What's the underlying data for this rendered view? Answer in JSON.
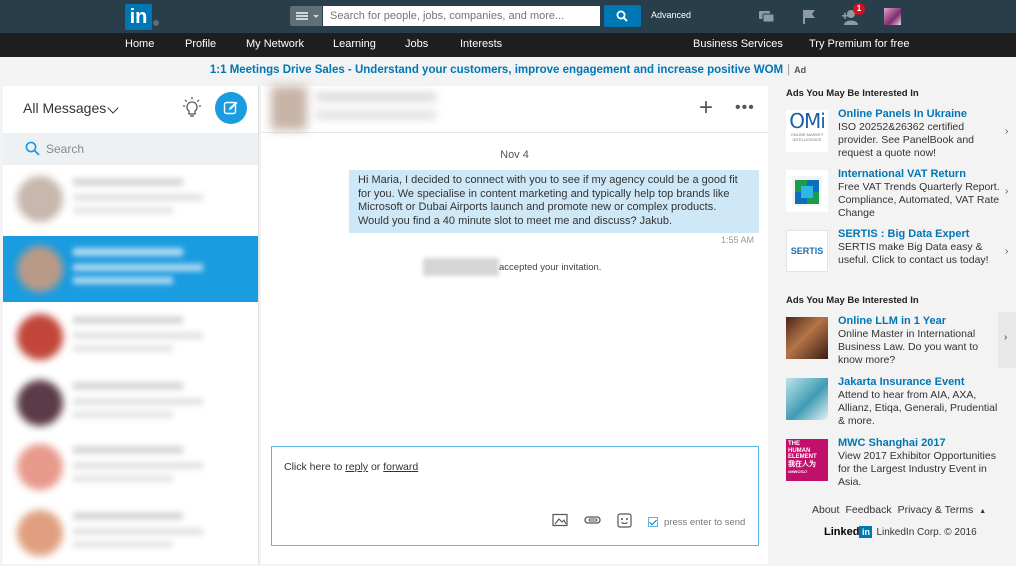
{
  "header": {
    "logo_text": "in",
    "search_placeholder": "Search for people, jobs, companies, and more...",
    "advanced_label": "Advanced",
    "notification_count": "1"
  },
  "nav": {
    "items": [
      "Home",
      "Profile",
      "My Network",
      "Learning",
      "Jobs",
      "Interests"
    ],
    "business_services": "Business Services",
    "premium": "Try Premium for free"
  },
  "promo": {
    "text": "1:1 Meetings Drive Sales - Understand your customers, improve engagement and increase positive WOM",
    "ad_label": "Ad"
  },
  "messages": {
    "header_label": "All Messages",
    "search_placeholder": "Search"
  },
  "conversation": {
    "date": "Nov 4",
    "message": "Hi Maria, I decided to connect with you to see if my agency could be a good fit for you. We specialise in content marketing and typically help top brands like Microsoft or Dubai Airports launch and promote new or complex products. Would you find a 40 minute slot to meet me and discuss? Jakub.",
    "message_time": "1:55 AM",
    "accepted_text": "accepted your invitation.",
    "reply_prefix": "Click here to ",
    "reply_link": "reply",
    "reply_or": " or ",
    "forward_link": "forward",
    "enter_label": "press enter to send"
  },
  "sidebar": {
    "ads_heading_1": "Ads You May Be Interested In",
    "ads_heading_2": "Ads You May Be Interested In",
    "ads_group1": [
      {
        "title": "Online Panels In Ukraine",
        "desc": "ISO 20252&26362 certified provider. See PanelBook and request a quote now!",
        "logo": "OMi",
        "logo_sub": "ONLINE MARKET INTELLIGENCE"
      },
      {
        "title": "International VAT Return",
        "desc": "Free VAT Trends Quarterly Report. Compliance, Automated, VAT Rate Change"
      },
      {
        "title": "SERTIS : Big Data Expert",
        "desc": "SERTIS make Big Data easy & useful. Click to contact us today!",
        "logo": "SERTIS"
      }
    ],
    "ads_group2": [
      {
        "title": "Online LLM in 1 Year",
        "desc": "Online Master in International Business Law. Do you want to know more?"
      },
      {
        "title": "Jakarta Insurance Event",
        "desc": "Attend to hear from AIA, AXA, Allianz, Etiqa, Generali, Prudential & more."
      },
      {
        "title": "MWC Shanghai 2017",
        "desc": "View 2017 Exhibitor Opportunities for the Largest Industry Event in Asia.",
        "logo": "THE HUMAN ELEMENT",
        "logo_cn": "我在人为",
        "logo_tag": "#MWCS17"
      }
    ],
    "footer_links": [
      "About",
      "Feedback",
      "Privacy & Terms"
    ],
    "brand_name": "Linked",
    "brand_in": "in",
    "copyright": "LinkedIn Corp. © 2016"
  },
  "colors": {
    "brand": "#0077b5",
    "topbar": "#283e4a",
    "selected": "#1a9ce0"
  }
}
